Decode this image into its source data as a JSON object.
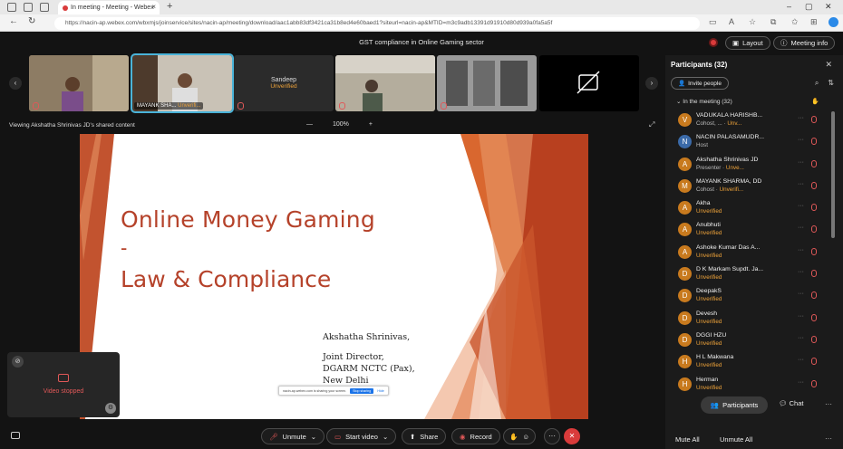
{
  "browser": {
    "tab_title": "In meeting - Meeting - Webex",
    "url": "https://nacin-ap.webex.com/wbxmjs/joinservice/sites/nacin-ap/meeting/download/aac1abb83df3421ca31b8ed4e60baed1?siteurl=nacin-ap&MTID=m3c9adb13391d91910d80d939a0fa5a5f",
    "new_tab": "+",
    "close": "×"
  },
  "meeting": {
    "title": "GST compliance in Online Gaming sector",
    "layout_label": "Layout",
    "info_label": "Meeting info",
    "viewing": "Viewing Akshatha Shrinivas JD's shared content",
    "zoom_minus": "—",
    "zoom_level": "100%",
    "zoom_plus": "+"
  },
  "thumbnails": [
    {
      "name": "",
      "unverified": ""
    },
    {
      "name": "MAYANK SHA...",
      "unverified": "Unverifi..."
    },
    {
      "name": "Sandeep",
      "unverified": "Unverified"
    },
    {
      "name": "",
      "unverified": ""
    },
    {
      "name": "",
      "unverified": ""
    },
    {
      "name": "",
      "unverified": ""
    }
  ],
  "slide": {
    "line1": "Online Money Gaming",
    "line2": "-",
    "line3": "Law & Compliance",
    "author": "Akshatha Shrinivas,",
    "role1": "Joint Director,",
    "role2": "DGARM NCTC (Pax),",
    "role3": "New Delhi",
    "share_notice": "nacin-ap.webex.com is sharing your screen.",
    "stop_sharing": "Stop sharing",
    "hide": "Hide"
  },
  "selfview": {
    "status": "Video stopped"
  },
  "controls": {
    "unmute": "Unmute",
    "start_video": "Start video",
    "share": "Share",
    "record": "Record",
    "more": "···",
    "leave": "✕",
    "participants": "Participants",
    "chat": "Chat"
  },
  "panel": {
    "title": "Participants (32)",
    "invite": "Invite people",
    "in_meeting": "In the meeting (32)",
    "mute_all": "Mute All",
    "unmute_all": "Unmute All",
    "more": "···",
    "participants": [
      {
        "name": "VADUKALA HARISHB...",
        "role": "Cohost, ...",
        "unverified": "Unv...",
        "initial": "V"
      },
      {
        "name": "NACIN PALASAMUDR...",
        "role": "Host",
        "unverified": "",
        "initial": "N"
      },
      {
        "name": "Akshatha Shrinivas JD",
        "role": "Presenter",
        "unverified": "Unve...",
        "initial": "A"
      },
      {
        "name": "MAYANK SHARMA, DD",
        "role": "Cohost",
        "unverified": "Unverifi...",
        "initial": "M"
      },
      {
        "name": "Akha",
        "role": "",
        "unverified": "Unverified",
        "initial": "A"
      },
      {
        "name": "Anubhuti",
        "role": "",
        "unverified": "Unverified",
        "initial": "A"
      },
      {
        "name": "Ashoke Kumar Das A...",
        "role": "",
        "unverified": "Unverified",
        "initial": "A"
      },
      {
        "name": "D K Markam Supdt. Ja...",
        "role": "",
        "unverified": "Unverified",
        "initial": "D"
      },
      {
        "name": "DeepakS",
        "role": "",
        "unverified": "Unverified",
        "initial": "D"
      },
      {
        "name": "Devesh",
        "role": "",
        "unverified": "Unverified",
        "initial": "D"
      },
      {
        "name": "DGGI HZU",
        "role": "",
        "unverified": "Unverified",
        "initial": "D"
      },
      {
        "name": "H L Makwana",
        "role": "",
        "unverified": "Unverified",
        "initial": "H"
      },
      {
        "name": "Herman",
        "role": "",
        "unverified": "Unverified",
        "initial": "H"
      }
    ]
  },
  "colors": {
    "accent_orange": "#f0a43a",
    "leave_red": "#d93b3b",
    "slide_title": "#b5422a"
  }
}
